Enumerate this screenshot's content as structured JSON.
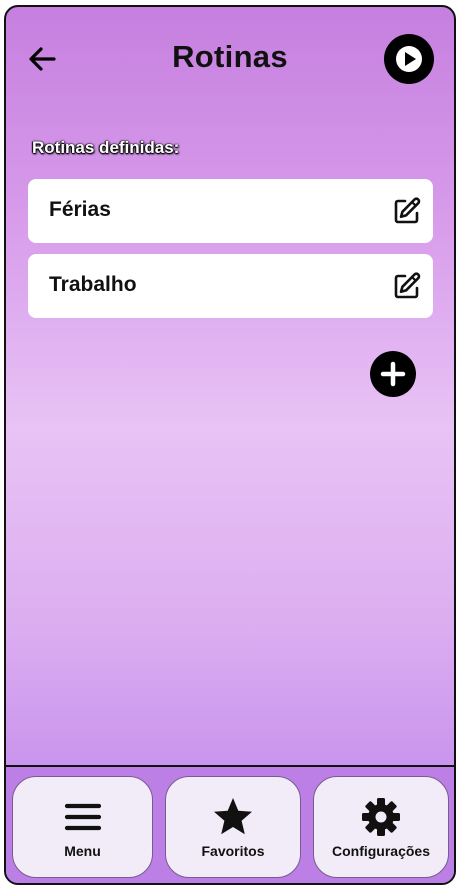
{
  "header": {
    "title": "Rotinas",
    "back_icon": "arrow-left-icon",
    "run_icon": "play-icon"
  },
  "section": {
    "label": "Rotinas definidas:"
  },
  "routines": [
    {
      "name": "Férias",
      "icon": "edit-icon"
    },
    {
      "name": "Trabalho",
      "icon": "edit-icon"
    }
  ],
  "add_button": {
    "icon": "plus-icon"
  },
  "bottom_nav": {
    "items": [
      {
        "label": "Menu",
        "icon": "hamburger-menu-icon"
      },
      {
        "label": "Favoritos",
        "icon": "star-icon"
      },
      {
        "label": "Configurações",
        "icon": "gear-icon"
      }
    ]
  },
  "colors": {
    "gradient_top": "#c67fdf",
    "gradient_mid": "#e8c3f5",
    "gradient_bottom": "#bb80ec",
    "card_bg": "#ffffff",
    "nav_button_bg": "#f1ecf7",
    "text": "#111111"
  }
}
